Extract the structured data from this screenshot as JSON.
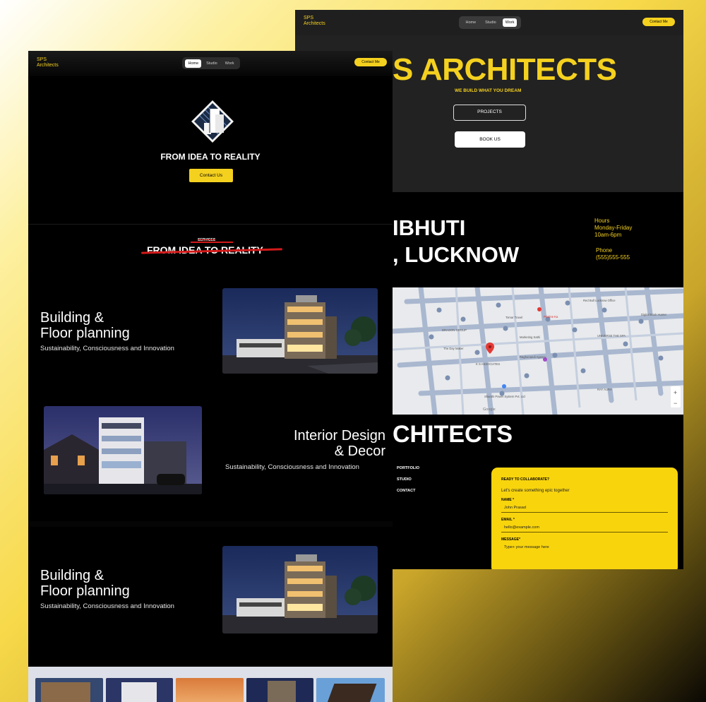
{
  "colors": {
    "accent": "#f5d11f",
    "background": "#000000",
    "form_yellow": "#f8d40d",
    "strike_red": "#d41a1a"
  },
  "right": {
    "brand": {
      "line1": "SPS",
      "line2": "Architects"
    },
    "nav": {
      "home": "Home",
      "studio": "Studio",
      "work": "Work",
      "active": "Work"
    },
    "contact_button": "Contact Me",
    "hero": {
      "title": "S ARCHITECTS",
      "tagline": "WE BUILD WHAT YOU DREAM",
      "projects_button": "PROJECTS",
      "book_button": "BOOK US"
    },
    "address": {
      "line1": "IBHUTI",
      "line2": ", LUCKNOW"
    },
    "hours": {
      "label": "Hours",
      "days": "Monday-Friday",
      "time": "10am-6pm"
    },
    "phone": {
      "label": "Phone",
      "number": "(555)555-555"
    },
    "map": {
      "labels": [
        "Tomar Travel",
        "Pristine Ka",
        "Red Bull Lucknow Office",
        "Digital Book Hunter",
        "Marketing Sathi",
        "Raghunandi Agency",
        "K S ASSOCIATES",
        "Shanthi Power System Pvt. Ltd",
        "UNIVERSE THE SPA",
        "DRAGON GROUP",
        "The Day Maker",
        "RAY AURA",
        "Google"
      ],
      "zoom_in": "+",
      "zoom_out": "−"
    },
    "footer": {
      "title": "CHITECTS",
      "links": [
        "PORTFOLIO",
        "STUDIO",
        "CONTACT"
      ]
    },
    "form": {
      "title": "READY TO COLLABORATE?",
      "subtitle": "Let's create something epic together",
      "name_label": "NAME *",
      "name_value": "John Prasad",
      "email_label": "EMAIL *",
      "email_value": "hello@example.com",
      "message_label": "MESSAGE*",
      "message_placeholder": "Type+ your message here"
    }
  },
  "left": {
    "brand": {
      "line1": "SPS",
      "line2": "Architects"
    },
    "nav": {
      "home": "Home",
      "studio": "Studio",
      "work": "Work",
      "active": "Home"
    },
    "contact_button": "Contact Me",
    "hero": {
      "title": "FROM IDEA TO REALITY",
      "button": "Contact Us"
    },
    "services": {
      "label": "SERVICES",
      "title": "FROM IDEA TO REALITY"
    },
    "sections": [
      {
        "heading1": "Building &",
        "heading2": "Floor planning",
        "sub": "Sustainability, Consciousness and Innovation"
      },
      {
        "heading1": "Interior Design",
        "heading2": "& Decor",
        "sub": "Sustainability, Consciousness and Innovation"
      },
      {
        "heading1": "Building &",
        "heading2": "Floor planning",
        "sub": "Sustainability, Consciousness and Innovation"
      }
    ]
  }
}
